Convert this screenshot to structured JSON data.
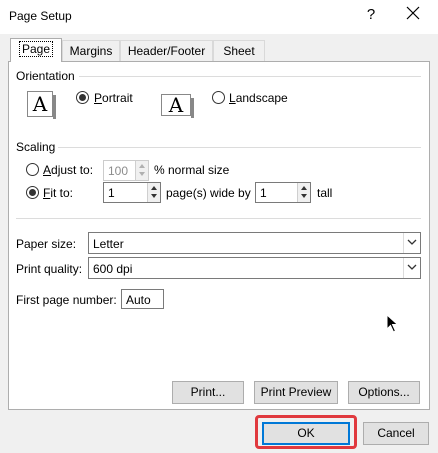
{
  "window": {
    "title": "Page Setup",
    "help_label": "?"
  },
  "tabs": [
    {
      "label": "Page",
      "active": true
    },
    {
      "label": "Margins",
      "active": false
    },
    {
      "label": "Header/Footer",
      "active": false
    },
    {
      "label": "Sheet",
      "active": false
    }
  ],
  "orientation": {
    "label": "Orientation",
    "icon_letter": "A",
    "portrait": {
      "prefix": "",
      "accel": "P",
      "suffix": "ortrait",
      "checked": true
    },
    "landscape": {
      "prefix": "",
      "accel": "L",
      "suffix": "andscape",
      "checked": false
    }
  },
  "scaling": {
    "label": "Scaling",
    "adjust_to": {
      "accel": "A",
      "suffix": "djust to:",
      "checked": false,
      "value": "100",
      "unit": "% normal size"
    },
    "fit_to": {
      "accel": "F",
      "suffix": "it to:",
      "checked": true,
      "wide_value": "1",
      "wide_label": "page(s) wide by",
      "tall_value": "1",
      "tall_label": "tall"
    }
  },
  "paper_size": {
    "accel": "Pap",
    "label": "Paper size:",
    "value": "Letter"
  },
  "print_quality": {
    "label": "Print quality:",
    "value": "600 dpi"
  },
  "first_page_number": {
    "label": "First page number:",
    "value": "Auto"
  },
  "buttons": {
    "print": "Print...",
    "print_preview": "Print Preview",
    "options": "Options...",
    "ok": "OK",
    "cancel": "Cancel"
  },
  "colors": {
    "highlight": "#e0393e",
    "default_button": "#0078d7"
  }
}
